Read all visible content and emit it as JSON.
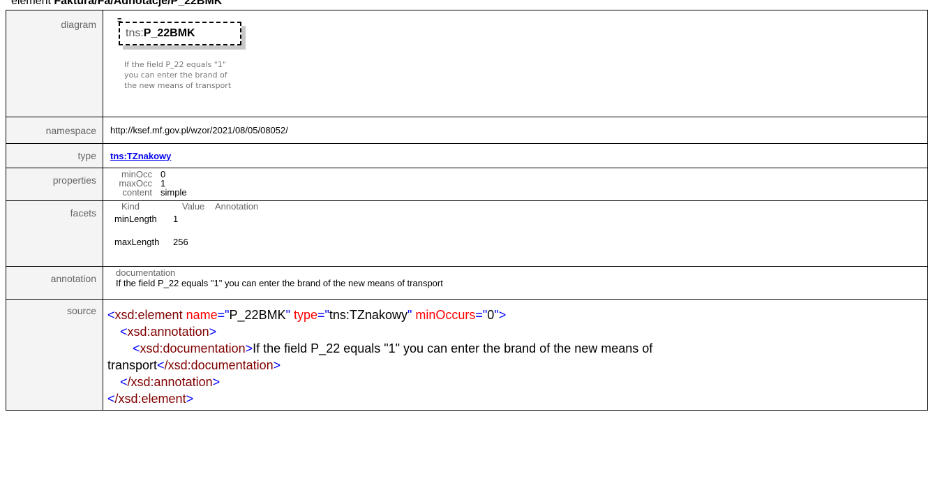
{
  "heading": {
    "prefix": "element ",
    "path": "Faktura/Fa/Adnotacje/P_22BMK"
  },
  "labels": {
    "diagram": "diagram",
    "namespace": "namespace",
    "type": "type",
    "properties": "properties",
    "facets": "facets",
    "annotation": "annotation",
    "source": "source"
  },
  "diagram": {
    "element_ns": "tns:",
    "element_name": "P_22BMK",
    "element_icon": "documentation-lines-icon",
    "description_lines": [
      "If the field P_22 equals \"1\"",
      "you can enter the brand of",
      "the new means of transport"
    ]
  },
  "namespace": "http://ksef.mf.gov.pl/wzor/2021/08/05/08052/",
  "type": "tns:TZnakowy",
  "properties": [
    {
      "key": "minOcc",
      "value": "0"
    },
    {
      "key": "maxOcc",
      "value": "1"
    },
    {
      "key": "content",
      "value": "simple"
    }
  ],
  "facets": {
    "headers": [
      "Kind",
      "Value",
      "Annotation"
    ],
    "rows": [
      {
        "kind": "minLength",
        "value": "1"
      },
      {
        "kind": "maxLength",
        "value": "256"
      }
    ]
  },
  "annotation": {
    "heading": "documentation",
    "text": "If the field P_22 equals \"1\" you can enter the brand of the new means of transport"
  },
  "source": {
    "open_tag": "xsd:element",
    "attr_name_key": "name",
    "attr_name_val": "P_22BMK",
    "attr_type_key": "type",
    "attr_type_val": "tns:TZnakowy",
    "attr_min_key": "minOccurs",
    "attr_min_val": "0",
    "annotation_tag": "xsd:annotation",
    "documentation_tag": "xsd:documentation",
    "documentation_text_1": "If the field P_22 equals \"1\" you can enter the brand of the new means of",
    "documentation_text_2": "transport",
    "close_documentation": "/xsd:documentation",
    "close_annotation": "/xsd:annotation",
    "close_element": "/xsd:element"
  },
  "colors": {
    "tag": "#800000",
    "punct": "#0000ff",
    "attr": "#ff0000",
    "link": "#0000ee",
    "label_bg": "#f4f4f4"
  }
}
